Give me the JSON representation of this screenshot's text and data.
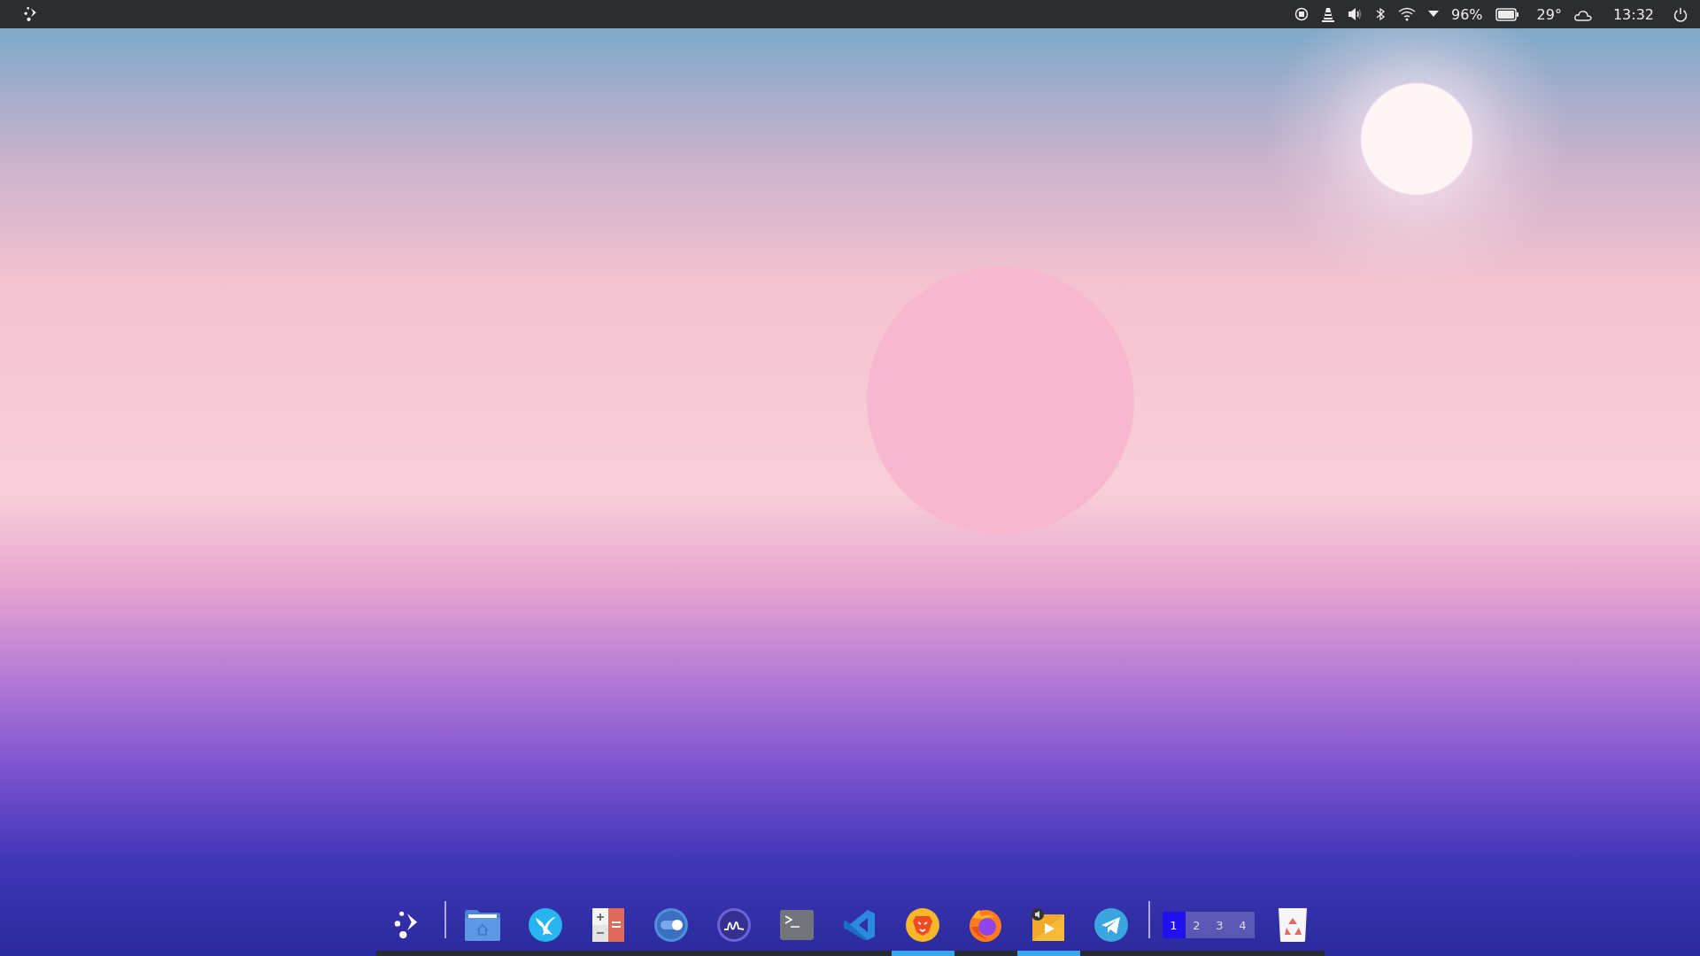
{
  "top_bar": {
    "battery": "96%",
    "weather": "29°",
    "clock": "13:32"
  },
  "dock": {
    "apps": [
      {
        "kind": "files",
        "running": false
      },
      {
        "kind": "bird",
        "running": false
      },
      {
        "kind": "calculator",
        "running": false
      },
      {
        "kind": "toggle",
        "running": false
      },
      {
        "kind": "monitor",
        "running": false
      },
      {
        "kind": "terminal",
        "running": false
      },
      {
        "kind": "code",
        "running": false
      },
      {
        "kind": "lion",
        "running": true
      },
      {
        "kind": "fox",
        "running": false
      },
      {
        "kind": "media",
        "running": true
      },
      {
        "kind": "plane",
        "running": false
      }
    ],
    "workspaces": [
      {
        "label": "1",
        "selected": true
      },
      {
        "label": "2",
        "selected": false
      },
      {
        "label": "3",
        "selected": false
      },
      {
        "label": "4",
        "selected": false
      }
    ]
  }
}
